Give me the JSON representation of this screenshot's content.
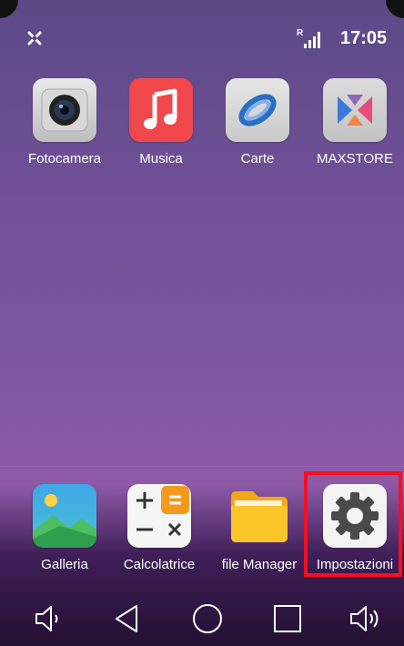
{
  "status_bar": {
    "time": "17:05",
    "network_badge": "R",
    "icons": [
      "notification-icon",
      "signal-icon"
    ]
  },
  "apps_top": [
    {
      "label": "Fotocamera",
      "icon": "camera-icon"
    },
    {
      "label": "Musica",
      "icon": "music-icon"
    },
    {
      "label": "Carte",
      "icon": "maps-icon"
    },
    {
      "label": "MAXSTORE",
      "icon": "maxstore-icon"
    }
  ],
  "dock": [
    {
      "label": "Galleria",
      "icon": "gallery-icon"
    },
    {
      "label": "Calcolatrice",
      "icon": "calculator-icon"
    },
    {
      "label": "file Manager",
      "icon": "folder-icon"
    },
    {
      "label": "Impostazioni",
      "icon": "settings-gear-icon"
    }
  ],
  "navigation": [
    "volume-down-icon",
    "back-icon",
    "home-icon",
    "recents-icon",
    "volume-up-icon"
  ],
  "colors": {
    "music_bg": "#f0474c",
    "highlight": "#ff0d1d",
    "folder": "#f7b21f",
    "calc_orange": "#f39a1e"
  }
}
